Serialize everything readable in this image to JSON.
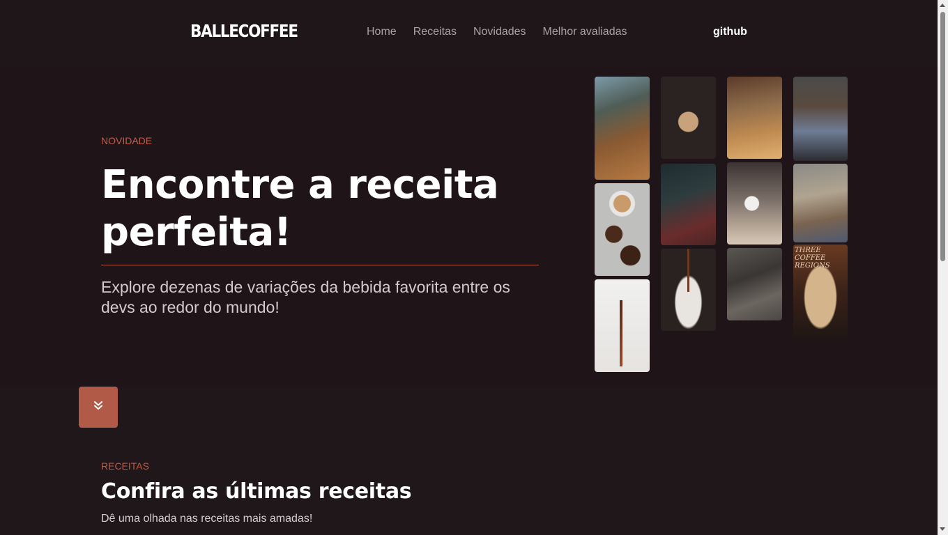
{
  "header": {
    "logo": "BALLECOFFEE",
    "nav": [
      {
        "label": "Home"
      },
      {
        "label": "Receitas"
      },
      {
        "label": "Novidades"
      },
      {
        "label": "Melhor avaliadas"
      }
    ],
    "github_label": "github"
  },
  "hero": {
    "eyebrow": "NOVIDADE",
    "title": "Encontre a receita perfeita!",
    "subtitle": "Explore dezenas de variações da bebida favorita entre os devs ao redor do mundo!",
    "photo_sign": "THREE COFFEE REGIONS"
  },
  "scroll_button": {
    "icon": "double-chevron-down-icon"
  },
  "recipes": {
    "eyebrow": "RECEITAS",
    "title": "Confira as últimas receitas",
    "subtitle": "Dê uma olhada nas receitas mais amadas!"
  },
  "colors": {
    "background": "#1f1719",
    "accent": "#b15a48",
    "eyebrow": "#c25c4a",
    "text": "#ffffff"
  }
}
